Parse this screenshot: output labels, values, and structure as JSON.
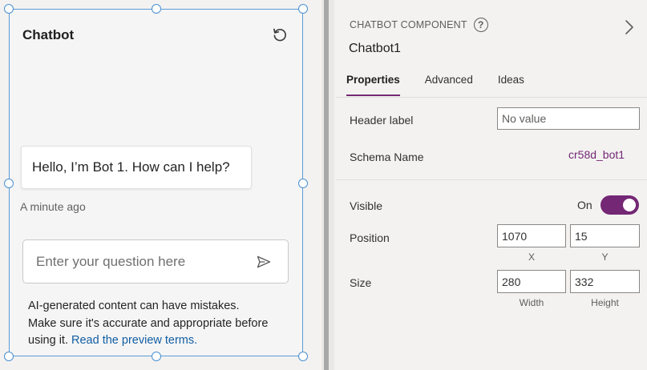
{
  "chatbot": {
    "title": "Chatbot",
    "bot_message": "Hello, I’m Bot 1. How can I help?",
    "timestamp": "A minute ago",
    "input_placeholder": "Enter your question here",
    "disclaimer_text": "AI-generated content can have mistakes. Make sure it's accurate and appropriate before using it.",
    "disclaimer_link": "Read the preview terms.",
    "icons": {
      "refresh": "refresh-icon",
      "send": "send-icon"
    }
  },
  "panel": {
    "kicker": "CHATBOT COMPONENT",
    "help_glyph": "?",
    "component_name": "Chatbot1",
    "tabs": [
      {
        "label": "Properties",
        "active": true
      },
      {
        "label": "Advanced",
        "active": false
      },
      {
        "label": "Ideas",
        "active": false
      }
    ],
    "header_label": {
      "label": "Header label",
      "placeholder": "No value"
    },
    "schema_name": {
      "label": "Schema Name",
      "value": "cr58d_bot1"
    },
    "visible": {
      "label": "Visible",
      "state": "On",
      "on": true
    },
    "position": {
      "label": "Position",
      "x": "1070",
      "y": "15",
      "x_caption": "X",
      "y_caption": "Y"
    },
    "size": {
      "label": "Size",
      "width": "280",
      "height": "332",
      "width_caption": "Width",
      "height_caption": "Height"
    }
  },
  "colors": {
    "accent": "#742774",
    "selection": "#4a8fd0",
    "link": "#115ea3"
  }
}
